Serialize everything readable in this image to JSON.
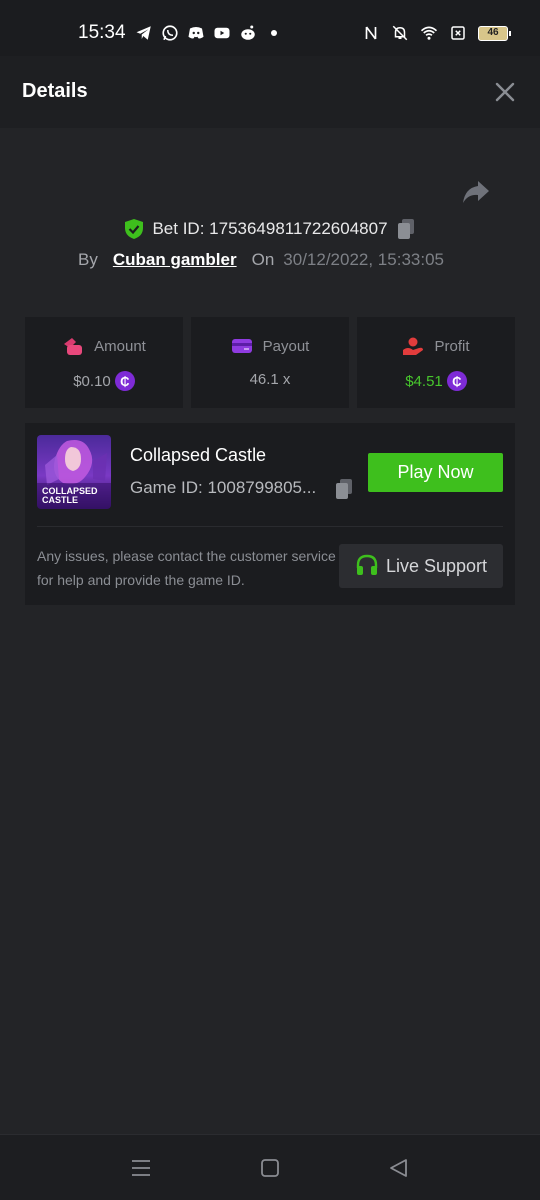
{
  "status_bar": {
    "time": "15:34",
    "battery": "46"
  },
  "header": {
    "title": "Details"
  },
  "bet": {
    "id_text": "Bet ID: 1753649811722604807",
    "by_label": "By",
    "user": "Cuban gambler",
    "on_label": "On",
    "date": "30/12/2022, 15:33:05"
  },
  "stats": [
    {
      "label": "Amount",
      "value": "$0.10",
      "icon": "money-bag-icon",
      "has_coin": true,
      "color": "#a4a6ab"
    },
    {
      "label": "Payout",
      "value": "46.1 x",
      "icon": "card-icon",
      "has_coin": false,
      "color": "#a4a6ab"
    },
    {
      "label": "Profit",
      "value": "$4.51",
      "icon": "profit-hand-icon",
      "has_coin": true,
      "color": "#47c52d"
    }
  ],
  "coin_symbol": "₵",
  "game": {
    "name": "Collapsed Castle",
    "id_text": "Game ID: 1008799805...",
    "thumb_text": [
      "COLLAPSED",
      "CASTLE"
    ],
    "play_label": "Play Now",
    "help_text": "Any issues, please contact the customer service for help and provide the game ID.",
    "support_label": "Live Support"
  },
  "colors": {
    "accent_green": "#3ebf1d",
    "coin_purple": "#7e2bd6",
    "background": "#232427"
  }
}
